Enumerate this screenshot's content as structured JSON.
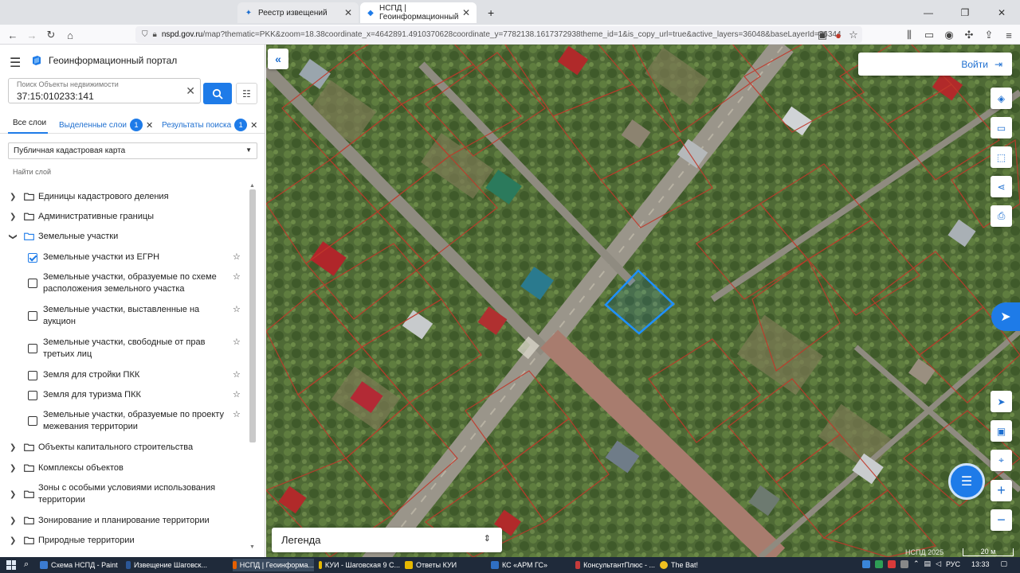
{
  "browser": {
    "tabs": [
      {
        "label": "Реестр извещений",
        "active": false
      },
      {
        "label": "НСПД | Геоинформационный",
        "active": true
      }
    ],
    "new_tab": "+",
    "url_host": "nspd.gov.ru",
    "url_rest": "/map?thematic=PKK&zoom=18.38coordinate_x=4642891.4910370628coordinate_y=7782138.1617372938theme_id=1&is_copy_url=true&active_layers=36048&baseLayerId=36344"
  },
  "panel": {
    "title": "Геоинформационный портал",
    "search": {
      "label": "Поиск Объекты недвижимости",
      "value": "37:15:010233:141"
    },
    "tabs": [
      {
        "label": "Все слои"
      },
      {
        "label": "Выделенные слои",
        "count": "1"
      },
      {
        "label": "Результаты поиска",
        "count": "1"
      }
    ],
    "basemap": "Публичная кадастровая карта",
    "find_layer": "Найти слой",
    "tree": {
      "cadastral_units": "Единицы кадастрового деления",
      "admin_borders": "Административные границы",
      "land_plots": "Земельные участки",
      "land_plots_children": {
        "egrn": "Земельные участки из ЕГРН",
        "scheme": "Земельные участки, образуемые по схеме расположения земельного участка",
        "auction": "Земельные участки, выставленные на аукцион",
        "free": "Земельные участки, свободные от прав третьих лиц",
        "pkk_build": "Земля для стройки ПКК",
        "pkk_tourism": "Земля для туризма ПКК",
        "survey": "Земельные участки, образуемые по проекту межевания территории"
      },
      "capital_objects": "Объекты капитального строительства",
      "object_complexes": "Комплексы объектов",
      "special_zones": "Зоны с особыми условиями использования территории",
      "zoning": "Зонирование и планирование территории",
      "natural": "Природные территории"
    }
  },
  "map": {
    "login": "Войти",
    "legend": "Легенда",
    "copyright": "НСПД 2025",
    "scale": "20 м"
  },
  "taskbar": {
    "items": [
      "Схема НСПД - Paint",
      "Извещение Шаговск...",
      "НСПД | Геоинформа...",
      "КУИ - Шаговская 9 С...",
      "Ответы КУИ",
      "КС «АРМ ГС»",
      "КонсультантПлюс - ...",
      "The Bat!"
    ],
    "lang": "РУС",
    "time": "13:33"
  },
  "colors": {
    "accent": "#1e7be8",
    "parcel_outline": "#c0392b",
    "selected_parcel": "#1e90ff"
  }
}
